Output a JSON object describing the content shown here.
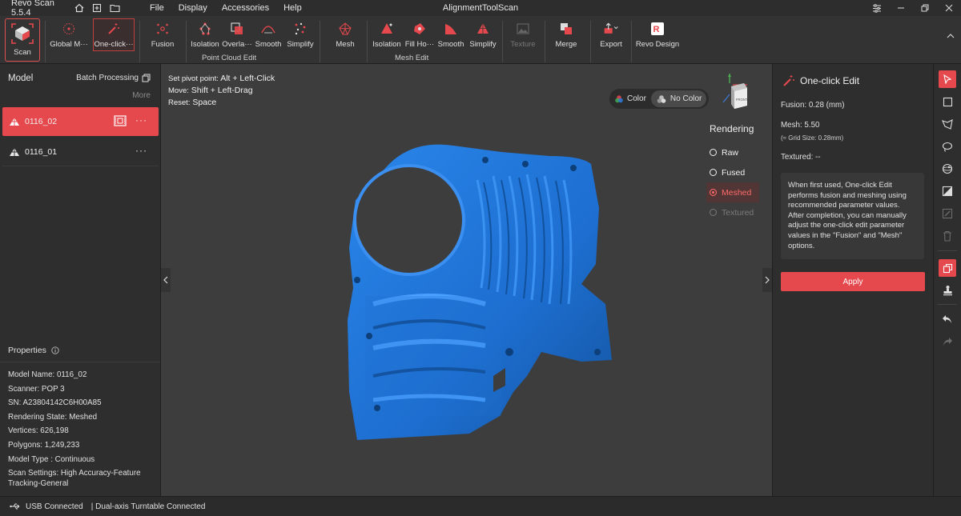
{
  "app": {
    "name": "Revo Scan 5.5.4",
    "window_title": "AlignmentToolScan"
  },
  "menu": [
    "File",
    "Display",
    "Accessories",
    "Help"
  ],
  "toolbar": {
    "scan": "Scan",
    "global": "Global M···",
    "oneclick": "One-click···",
    "fusion": "Fusion",
    "pc_isolation": "Isolation",
    "pc_overlap": "Overla···",
    "pc_smooth": "Smooth",
    "pc_simplify": "Simplify",
    "point_cloud_group": "Point Cloud Edit",
    "mesh": "Mesh",
    "m_isolation": "Isolation",
    "m_fillhole": "Fill Ho···",
    "m_smooth": "Smooth",
    "m_simplify": "Simplify",
    "mesh_group": "Mesh Edit",
    "texture": "Texture",
    "merge": "Merge",
    "export": "Export",
    "revo_design": "Revo Design"
  },
  "left": {
    "title": "Model",
    "batch": "Batch Processing",
    "more": "More",
    "models": [
      {
        "name": "0116_02",
        "active": true
      },
      {
        "name": "0116_01",
        "active": false
      }
    ],
    "properties_title": "Properties",
    "properties": [
      "Model Name:  0116_02",
      "Scanner:  POP 3",
      "SN:  A23804142C6H00A85",
      "Rendering State:  Meshed",
      "Vertices:  626,198",
      "Polygons:  1,249,233",
      "Model Type :  Continuous",
      "Scan Settings:  High Accuracy-Feature",
      "Tracking-General"
    ]
  },
  "viewport": {
    "hint1_label": "Set pivot point:",
    "hint1_value": "Alt + Left-Click",
    "hint2_label": "Move:",
    "hint2_value": "Shift + Left-Drag",
    "hint3_label": "Reset:",
    "hint3_value": "Space",
    "color": "Color",
    "no_color": "No Color",
    "rendering_title": "Rendering",
    "rendering_options": [
      "Raw",
      "Fused",
      "Meshed",
      "Textured"
    ],
    "rendering_selected": "Meshed",
    "gizmo_face": "FRONT",
    "model_color": "#1f6fd0"
  },
  "right": {
    "title": "One-click Edit",
    "fusion": "Fusion:   0.28 (mm)",
    "mesh": "Mesh:   5.50",
    "grid": "(≈ Grid Size: 0.28mm)",
    "textured": "Textured: --",
    "description": "When first used, One-click Edit performs fusion and meshing using recommended parameter values. After completion, you can manually adjust the one-click edit parameter values in the \"Fusion\" and \"Mesh\" options.",
    "apply": "Apply"
  },
  "status": {
    "usb": "USB Connected",
    "turntable": "| Dual-axis Turntable Connected"
  },
  "accent": "#e5484d"
}
